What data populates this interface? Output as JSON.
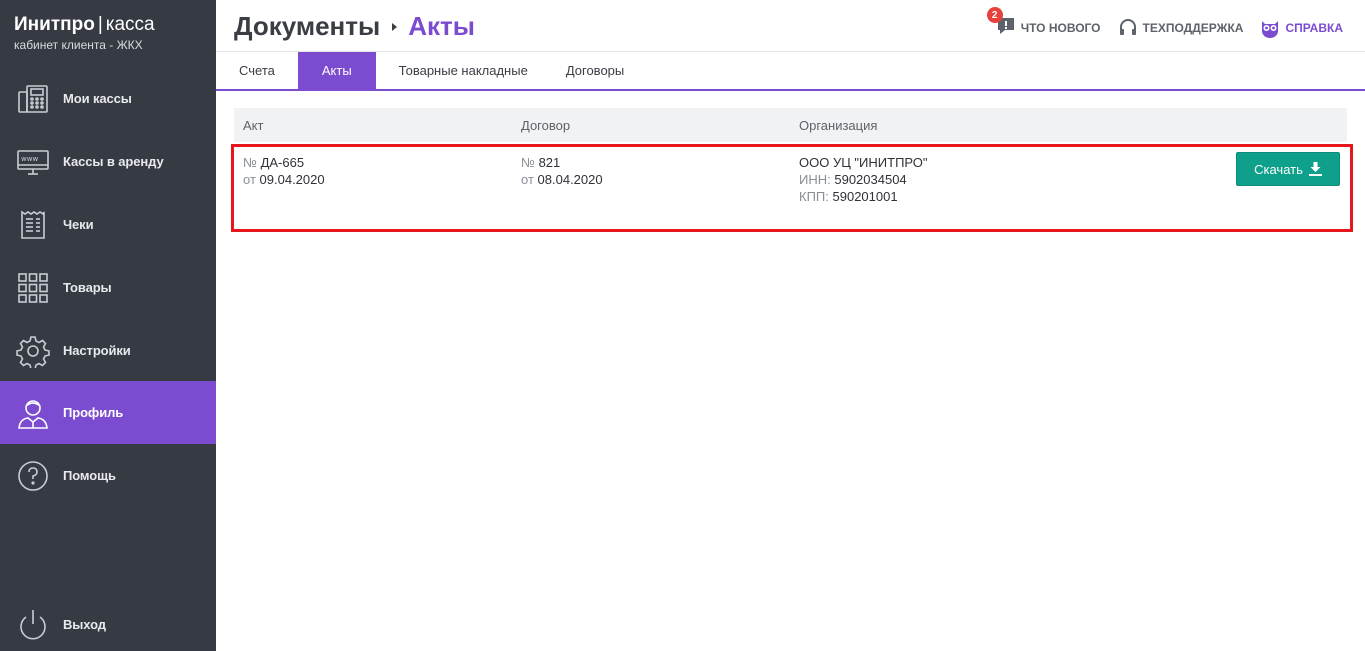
{
  "brand": {
    "name": "Инитпро",
    "separator": "|",
    "product": "касса",
    "subtitle": "кабинет клиента - ЖКХ"
  },
  "nav": [
    {
      "label": "Мои кассы",
      "icon": "register-icon",
      "active": false
    },
    {
      "label": "Кассы в аренду",
      "icon": "web-monitor-icon",
      "active": false
    },
    {
      "label": "Чеки",
      "icon": "receipt-icon",
      "active": false
    },
    {
      "label": "Товары",
      "icon": "grid-icon",
      "active": false
    },
    {
      "label": "Настройки",
      "icon": "gear-icon",
      "active": false
    },
    {
      "label": "Профиль",
      "icon": "user-icon",
      "active": true
    },
    {
      "label": "Помощь",
      "icon": "question-icon",
      "active": false
    },
    {
      "label": "Выход",
      "icon": "power-icon",
      "active": false
    }
  ],
  "header": {
    "breadcrumb_root": "Документы",
    "breadcrumb_current": "Акты",
    "links": {
      "news_label": "ЧТО НОВОГО",
      "news_badge": "2",
      "support_label": "ТЕХПОДДЕРЖКА",
      "help_label": "СПРАВКА"
    }
  },
  "tabs": [
    {
      "label": "Счета",
      "active": false
    },
    {
      "label": "Акты",
      "active": true
    },
    {
      "label": "Товарные накладные",
      "active": false
    },
    {
      "label": "Договоры",
      "active": false
    }
  ],
  "table": {
    "columns": [
      "Акт",
      "Договор",
      "Организация"
    ],
    "rows": [
      {
        "act_number_prefix": "№",
        "act_number": "ДА-665",
        "act_date_prefix": "от",
        "act_date": "09.04.2020",
        "contract_number_prefix": "№",
        "contract_number": "821",
        "contract_date_prefix": "от",
        "contract_date": "08.04.2020",
        "org_name": "ООО УЦ \"ИНИТПРО\"",
        "inn_label": "ИНН:",
        "inn": "5902034504",
        "kpp_label": "КПП:",
        "kpp": "590201001",
        "download_label": "Скачать"
      }
    ]
  },
  "colors": {
    "sidebar": "#363a43",
    "accent": "#7b4ccf",
    "download": "#0fa08c",
    "highlight": "#e8161c"
  }
}
